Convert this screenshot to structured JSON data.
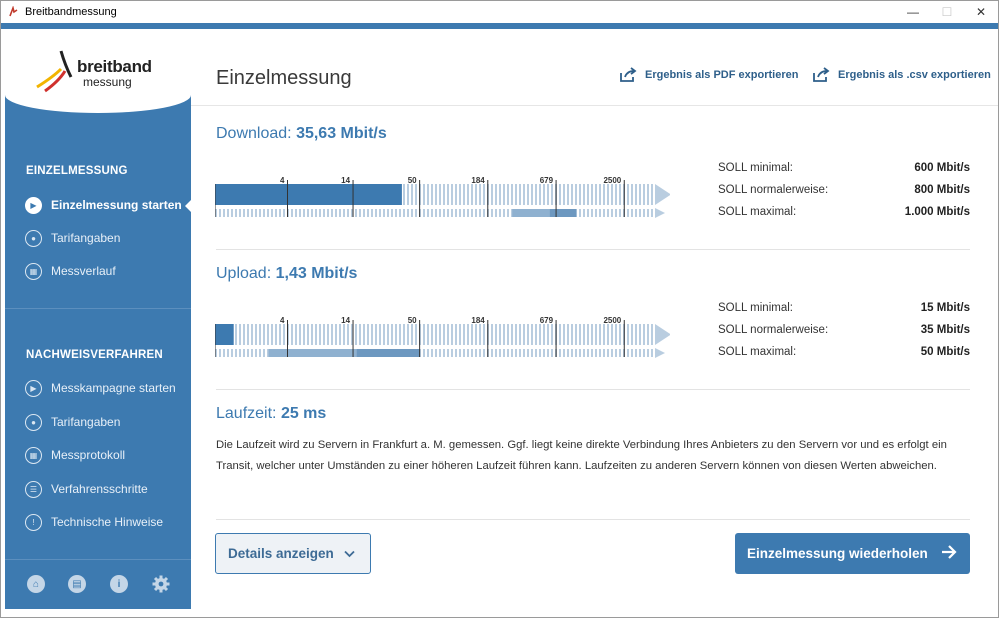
{
  "window": {
    "title": "Breitbandmessung",
    "controls": [
      "—",
      "☐",
      "✕"
    ]
  },
  "sidebar": {
    "logo_main": "breitband",
    "logo_sub": "messung",
    "section1": "EINZELMESSUNG",
    "section1_items": [
      {
        "label": "Einzelmessung starten",
        "icon": "play-icon",
        "active": true
      },
      {
        "label": "Tarifangaben",
        "icon": "users-icon",
        "active": false
      },
      {
        "label": "Messverlauf",
        "icon": "calendar-icon",
        "active": false
      }
    ],
    "section2": "NACHWEISVERFAHREN",
    "section2_items": [
      {
        "label": "Messkampagne starten",
        "icon": "play-icon"
      },
      {
        "label": "Tarifangaben",
        "icon": "users-icon"
      },
      {
        "label": "Messprotokoll",
        "icon": "calendar-icon"
      },
      {
        "label": "Verfahrensschritte",
        "icon": "list-icon"
      },
      {
        "label": "Technische Hinweise",
        "icon": "warning-icon"
      }
    ],
    "bottom_icons": [
      "home-icon",
      "chat-icon",
      "info-icon",
      "gear-icon"
    ]
  },
  "main": {
    "title": "Einzelmessung",
    "export_pdf": "Ergebnis als PDF exportieren",
    "export_csv": "Ergebnis als .csv exportieren",
    "download": {
      "label": "Download:",
      "value": "35,63 Mbit/s",
      "soll": [
        {
          "label": "SOLL minimal:",
          "value": "600 Mbit/s"
        },
        {
          "label": "SOLL normalerweise:",
          "value": "800 Mbit/s"
        },
        {
          "label": "SOLL maximal:",
          "value": "1.000 Mbit/s"
        }
      ]
    },
    "upload": {
      "label": "Upload:",
      "value": "1,43 Mbit/s",
      "soll": [
        {
          "label": "SOLL minimal:",
          "value": "15 Mbit/s"
        },
        {
          "label": "SOLL normalerweise:",
          "value": "35 Mbit/s"
        },
        {
          "label": "SOLL maximal:",
          "value": "50 Mbit/s"
        }
      ]
    },
    "scale_ticks": [
      "4",
      "14",
      "50",
      "184",
      "679",
      "2500"
    ],
    "latency": {
      "label": "Laufzeit:",
      "value": "25 ms"
    },
    "description": "Die Laufzeit wird zu Servern in Frankfurt a. M. gemessen. Ggf. liegt keine direkte Verbindung Ihres Anbieters zu den Servern vor und es erfolgt ein Transit, welcher unter Umständen zu einer höheren Laufzeit führen kann. Laufzeiten zu anderen Servern können von diesen Werten abweichen.",
    "btn_details": "Details anzeigen",
    "btn_repeat": "Einzelmessung wiederholen"
  },
  "colors": {
    "accent": "#3d7ab0",
    "bar_fill": "#3d7ab0",
    "bar_track": "#b9cde0",
    "range_mid": "#8fb1d0",
    "range_strong": "#6d98c0"
  }
}
